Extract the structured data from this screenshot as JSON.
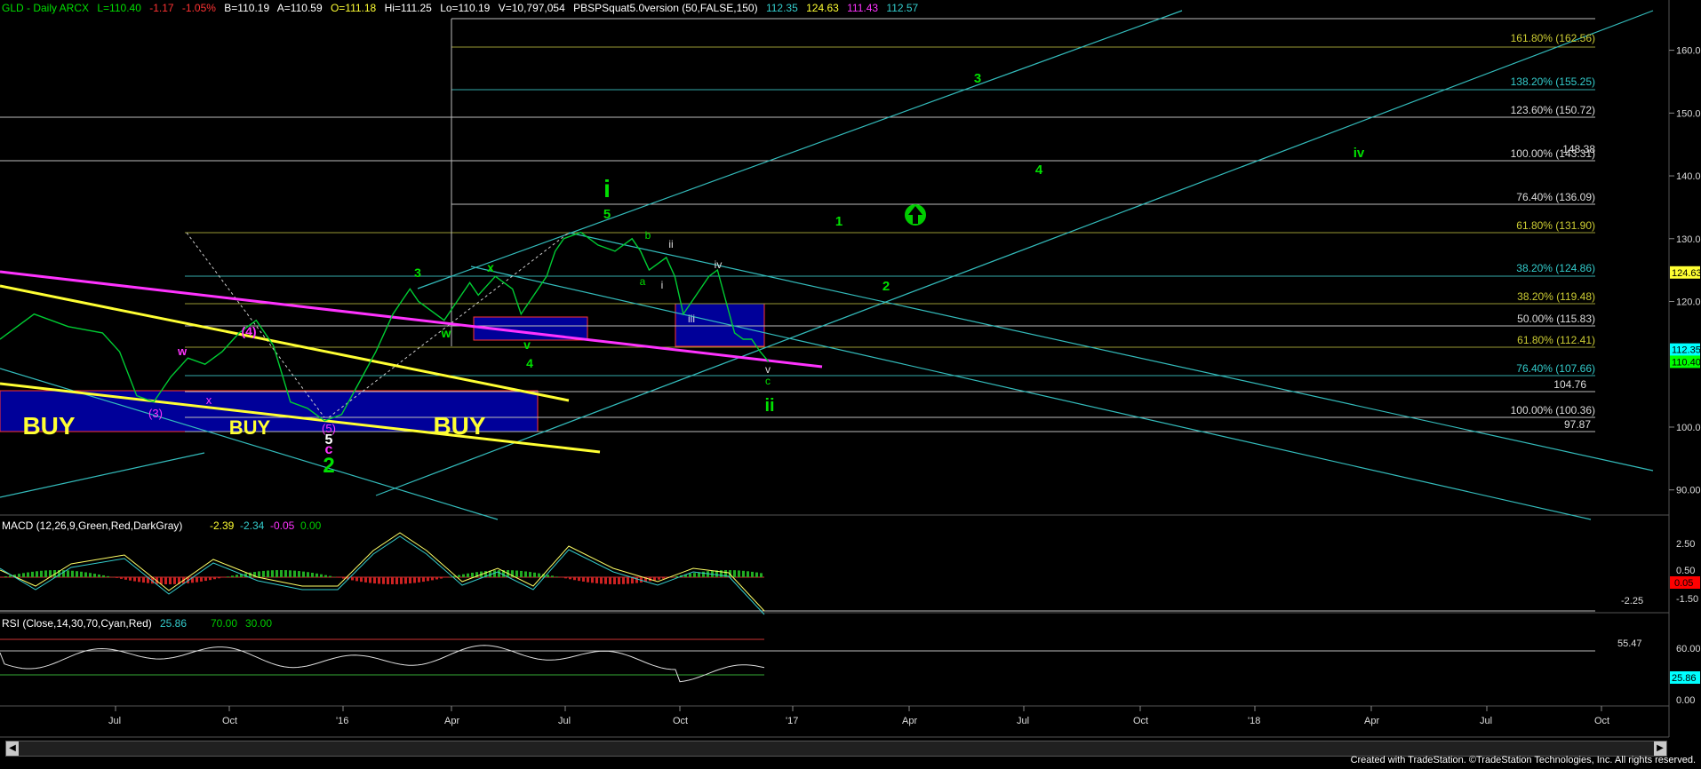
{
  "header": {
    "symbol": "GLD - Daily  ARCX",
    "last": "L=110.40",
    "chg": "-1.17",
    "pct": "-1.05%",
    "bid": "B=110.19",
    "ask": "A=110.59",
    "open": "O=111.18",
    "hi": "Hi=111.25",
    "lo": "Lo=110.19",
    "vol": "V=10,797,054",
    "indicator": "PBSPSquat5.0version (50,FALSE,150)",
    "v1": "112.35",
    "v2": "124.63",
    "v3": "111.43",
    "v4": "112.57"
  },
  "colors": {
    "green": "#00e000",
    "bright_green": "#33ff33",
    "cyan": "#33cccc",
    "magenta": "#ff33ff",
    "yellow": "#ffff33",
    "blue_box": "#000099",
    "fib_white": "#dddddd"
  },
  "x_ticks": [
    "Jul",
    "Oct",
    "'16",
    "Apr",
    "Jul",
    "Oct",
    "'17",
    "Apr",
    "Jul",
    "Oct",
    "'18",
    "Apr",
    "Jul",
    "Oct"
  ],
  "price_ticks": [
    "160.00",
    "150.00",
    "140.00",
    "130.00",
    "120.00",
    "100.00",
    "90.00"
  ],
  "price_badges": [
    {
      "text": "124.63",
      "bg": "#ffff33",
      "fg": "#000"
    },
    {
      "text": "112.35",
      "bg": "#00ffff",
      "fg": "#000"
    },
    {
      "text": "110.40",
      "bg": "#00ff00",
      "fg": "#000"
    }
  ],
  "fib_labels": [
    {
      "text": "161.80% (162.56)",
      "color": "#cccc33"
    },
    {
      "text": "138.20% (155.25)",
      "color": "#33cccc"
    },
    {
      "text": "123.60% (150.72)",
      "color": "#dddddd"
    },
    {
      "text": "100.00% (143.31)",
      "color": "#dddddd"
    },
    {
      "text": "148.38",
      "color": "#dddddd"
    },
    {
      "text": "76.40% (136.09)",
      "color": "#dddddd"
    },
    {
      "text": "61.80% (131.90)",
      "color": "#cccc33"
    },
    {
      "text": "38.20% (124.86)",
      "color": "#33cccc"
    },
    {
      "text": "38.20% (119.48)",
      "color": "#cccc33"
    },
    {
      "text": "50.00% (115.83)",
      "color": "#dddddd"
    },
    {
      "text": "61.80% (112.41)",
      "color": "#cccc33"
    },
    {
      "text": "76.40% (107.66)",
      "color": "#33cccc"
    },
    {
      "text": "104.76",
      "color": "#dddddd"
    },
    {
      "text": "100.00% (100.36)",
      "color": "#dddddd"
    },
    {
      "text": "97.87",
      "color": "#dddddd"
    }
  ],
  "wave_labels": [
    {
      "text": "BUY",
      "color": "#ffff33"
    },
    {
      "text": "BUY",
      "color": "#ffff33"
    },
    {
      "text": "BUY",
      "color": "#ffff33"
    },
    {
      "text": "(4)",
      "color": "#ff33ff"
    },
    {
      "text": "w",
      "color": "#ff33ff"
    },
    {
      "text": "x",
      "color": "#ff33ff"
    },
    {
      "text": "(3)",
      "color": "#ff33ff"
    },
    {
      "text": "(5)",
      "color": "#ff33ff"
    },
    {
      "text": "5",
      "color": "#ffffff"
    },
    {
      "text": "c",
      "color": "#ff33ff"
    },
    {
      "text": "2",
      "color": "#00e000"
    },
    {
      "text": "3",
      "color": "#00e000"
    },
    {
      "text": "x",
      "color": "#00e000"
    },
    {
      "text": "w",
      "color": "#00e000"
    },
    {
      "text": "v",
      "color": "#00e000"
    },
    {
      "text": "4",
      "color": "#00e000"
    },
    {
      "text": "i",
      "color": "#00e000"
    },
    {
      "text": "5",
      "color": "#00e000"
    },
    {
      "text": "b",
      "color": "#00e000"
    },
    {
      "text": "a",
      "color": "#00e000"
    },
    {
      "text": "ii",
      "color": "#dddddd"
    },
    {
      "text": "i",
      "color": "#dddddd"
    },
    {
      "text": "iv",
      "color": "#dddddd"
    },
    {
      "text": "iii",
      "color": "#dddddd"
    },
    {
      "text": "v",
      "color": "#dddddd"
    },
    {
      "text": "c",
      "color": "#00e000"
    },
    {
      "text": "ii",
      "color": "#00e000"
    },
    {
      "text": "1",
      "color": "#00e000"
    },
    {
      "text": "2",
      "color": "#00e000"
    },
    {
      "text": "3",
      "color": "#00e000"
    },
    {
      "text": "4",
      "color": "#00e000"
    },
    {
      "text": "iv",
      "color": "#00e000"
    }
  ],
  "macd": {
    "label": "MACD (12,26,9,Green,Red,DarkGray)",
    "v1": "-2.39",
    "v2": "-2.34",
    "v3": "-0.05",
    "v4": "0.00",
    "ticks": [
      "2.50",
      "0.50",
      "-1.50"
    ],
    "badge": "0.05",
    "level_label": "-2.25"
  },
  "rsi": {
    "label": "RSI (Close,14,30,70,Cyan,Red)",
    "v1": "25.86",
    "v2": "70.00",
    "v3": "30.00",
    "ticks": [
      "60.00",
      "0.00"
    ],
    "badge": "25.86",
    "level_label": "55.47"
  },
  "footer": "Created with TradeStation. ©TradeStation Technologies, Inc. All rights reserved.",
  "chart_data": {
    "type": "line",
    "title": "GLD - Daily ARCX",
    "price_ylim": [
      86,
      168
    ],
    "x": [
      "Jul",
      "Oct",
      "'16",
      "Apr",
      "Jul",
      "Oct",
      "'17",
      "Apr",
      "Jul",
      "Oct",
      "'18",
      "Apr",
      "Jul",
      "Oct"
    ],
    "series": [
      {
        "name": "GLD",
        "values": [
          [
            0.0,
            114
          ],
          [
            0.02,
            118
          ],
          [
            0.04,
            116
          ],
          [
            0.06,
            115
          ],
          [
            0.07,
            112
          ],
          [
            0.08,
            105
          ],
          [
            0.09,
            104
          ],
          [
            0.1,
            108
          ],
          [
            0.11,
            111
          ],
          [
            0.12,
            110
          ],
          [
            0.13,
            112
          ],
          [
            0.14,
            115
          ],
          [
            0.15,
            117
          ],
          [
            0.16,
            113
          ],
          [
            0.17,
            104
          ],
          [
            0.18,
            103
          ],
          [
            0.19,
            101
          ],
          [
            0.2,
            102
          ],
          [
            0.21,
            107
          ],
          [
            0.22,
            112
          ],
          [
            0.23,
            118
          ],
          [
            0.24,
            122
          ],
          [
            0.245,
            120
          ],
          [
            0.26,
            117
          ],
          [
            0.27,
            121
          ],
          [
            0.275,
            123
          ],
          [
            0.28,
            121
          ],
          [
            0.29,
            124
          ],
          [
            0.3,
            122
          ],
          [
            0.305,
            118
          ],
          [
            0.31,
            120
          ],
          [
            0.32,
            124
          ],
          [
            0.325,
            128
          ],
          [
            0.33,
            130
          ],
          [
            0.34,
            131
          ],
          [
            0.35,
            129
          ],
          [
            0.36,
            128
          ],
          [
            0.37,
            130
          ],
          [
            0.375,
            128
          ],
          [
            0.38,
            125
          ],
          [
            0.39,
            127
          ],
          [
            0.395,
            124
          ],
          [
            0.4,
            118
          ],
          [
            0.41,
            122
          ],
          [
            0.415,
            124
          ],
          [
            0.42,
            125
          ],
          [
            0.425,
            120
          ],
          [
            0.43,
            115
          ],
          [
            0.435,
            114
          ],
          [
            0.44,
            114
          ],
          [
            0.445,
            112
          ],
          [
            0.45,
            110.4
          ]
        ]
      }
    ]
  }
}
